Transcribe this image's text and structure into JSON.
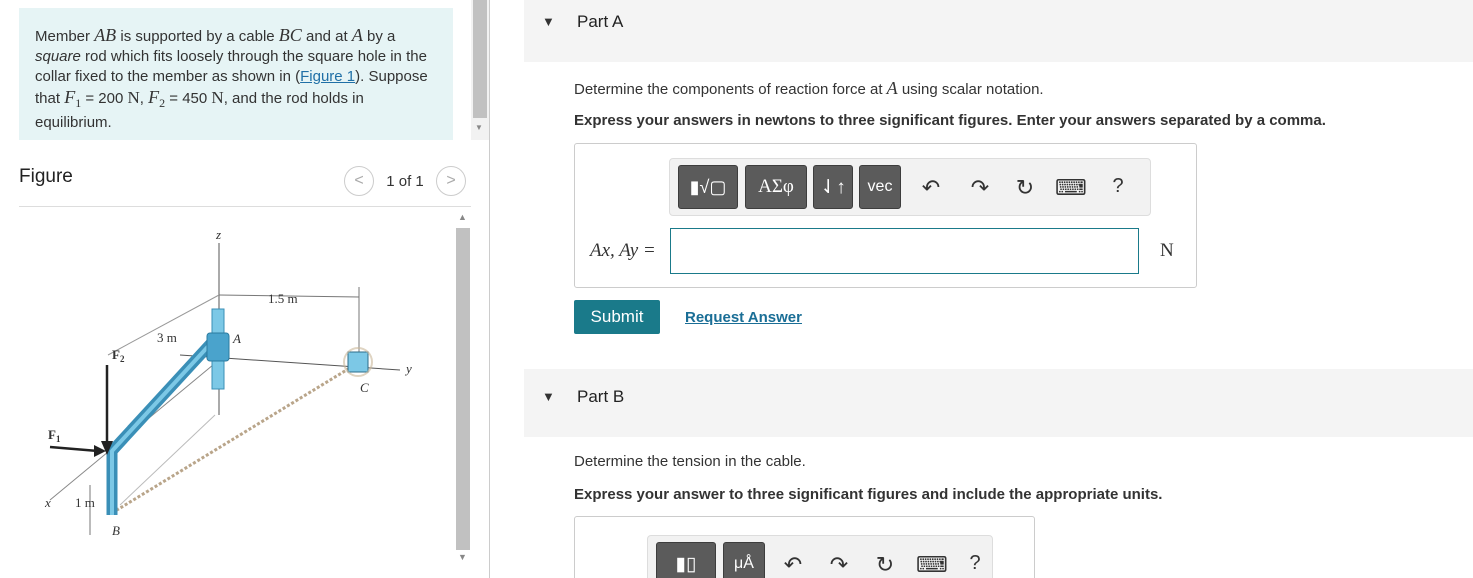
{
  "problem": {
    "t1": "Member ",
    "AB": "AB",
    "t2": " is supported by a cable ",
    "BC": "BC",
    "t3": " and at ",
    "A": "A",
    "t4": " by a ",
    "square": "square",
    "t5": " rod which fits loosely through the square hole in the collar fixed to the member as shown in (",
    "figure_link": "Figure 1",
    "t6": "). Suppose that ",
    "F1": "F",
    "F1sub": "1",
    "F1val": " = 200 ",
    "unitN1": "N",
    "t7": ", ",
    "F2": "F",
    "F2sub": "2",
    "F2val": " = 450 ",
    "unitN2": "N",
    "t8": ", and the rod holds in equilibrium."
  },
  "figure": {
    "title": "Figure",
    "pager": "1 of 1",
    "prev": "<",
    "next": ">",
    "labels": {
      "z": "z",
      "dim15": "1.5 m",
      "dim3": "3 m",
      "A": "A",
      "F2": "F",
      "F2sub": "2",
      "C": "C",
      "y": "y",
      "F1": "F",
      "F1sub": "1",
      "x": "x",
      "dim1": "1 m",
      "B": "B"
    }
  },
  "partA": {
    "title": "Part A",
    "q1": "Determine the components of reaction force at ",
    "qA": "A",
    "q2": " using scalar notation.",
    "instruction": "Express your answers in newtons to three significant figures. Enter your answers separated by a comma.",
    "toolbar": {
      "templates": "▮√▢",
      "greek": "ΑΣφ",
      "arrows": "⇃↑",
      "vec": "vec",
      "undo": "↶",
      "redo": "↷",
      "reset": "↻",
      "keyboard": "⌨",
      "help": "?"
    },
    "answer_label": "Ax, Ay =",
    "answer_value": "",
    "unit": "N",
    "submit": "Submit",
    "request": "Request Answer"
  },
  "partB": {
    "title": "Part B",
    "question": "Determine the tension in the cable.",
    "instruction": "Express your answer to three significant figures and include the appropriate units.",
    "toolbar": {
      "templates": "▮▯",
      "units": "μÅ",
      "undo": "↶",
      "redo": "↷",
      "reset": "↻",
      "keyboard": "⌨",
      "help": "?"
    }
  }
}
